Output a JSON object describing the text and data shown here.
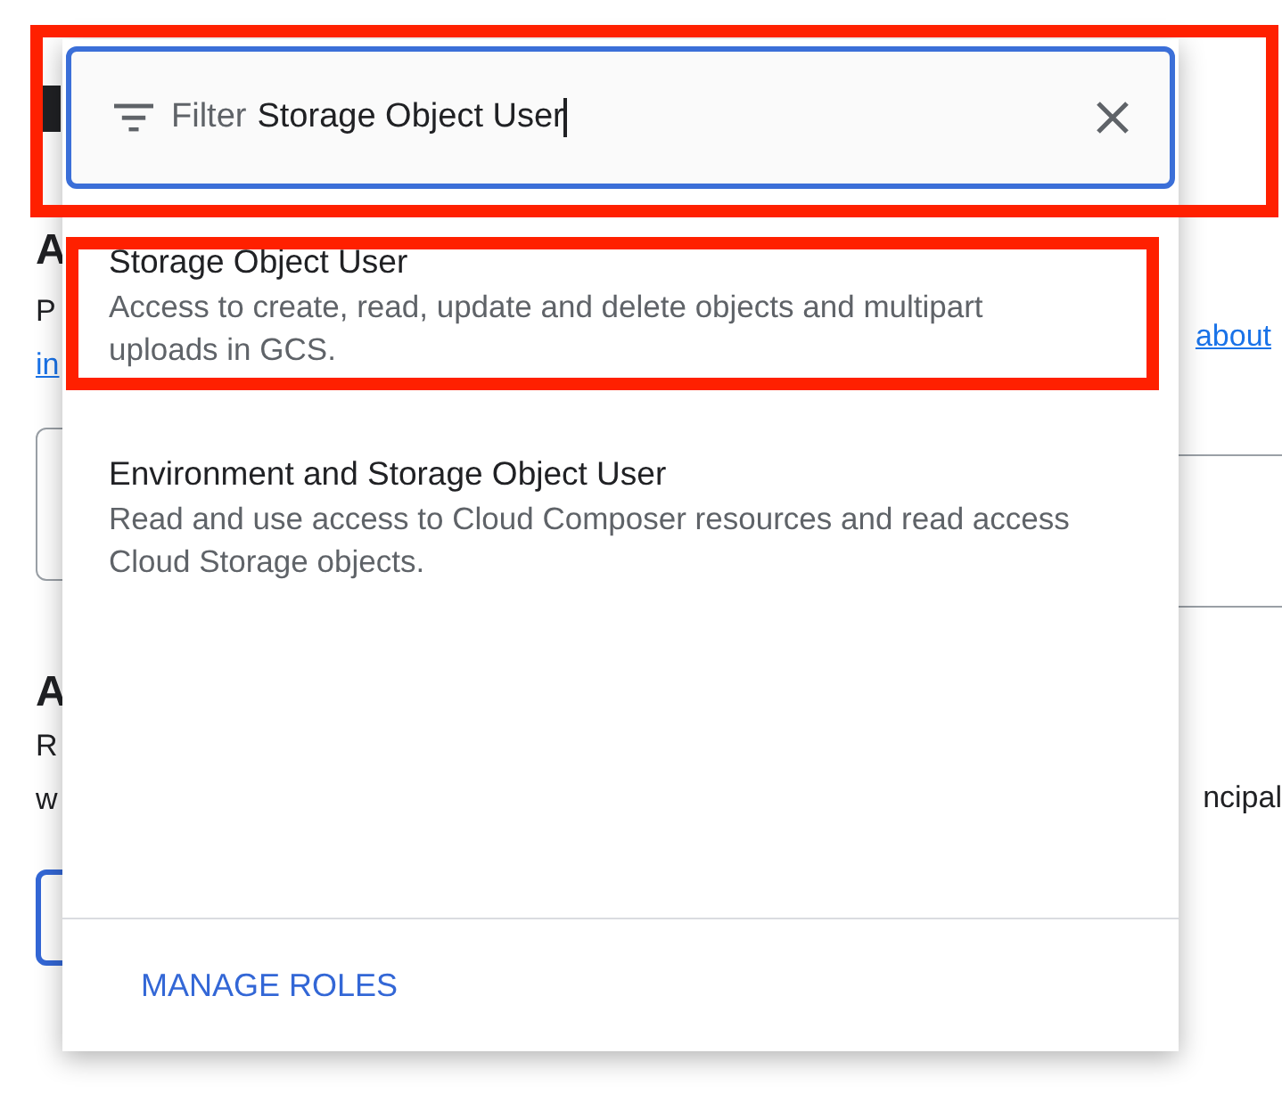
{
  "background": {
    "left": [
      {
        "kind": "heading",
        "text": "A"
      },
      {
        "kind": "text",
        "text": "P"
      },
      {
        "kind": "link",
        "text": "in"
      },
      {
        "kind": "field"
      },
      {
        "kind": "heading",
        "text": "A"
      },
      {
        "kind": "text",
        "text": "R"
      },
      {
        "kind": "text",
        "text": "w"
      },
      {
        "kind": "outline"
      }
    ],
    "right": [
      {
        "kind": "link",
        "text": "about"
      },
      {
        "kind": "field"
      },
      {
        "kind": "text",
        "text": "ncipal"
      }
    ]
  },
  "filter": {
    "label": "Filter",
    "value": "Storage Object User",
    "highlighted": true
  },
  "options": [
    {
      "title": "Storage Object User",
      "description": "Access to create, read, update and delete objects and multipart uploads in GCS.",
      "highlighted": true
    },
    {
      "title": "Environment and Storage Object User",
      "description": "Read and use access to Cloud Composer resources and read access Cloud Storage objects.",
      "highlighted": false
    }
  ],
  "footer_button": "MANAGE ROLES"
}
